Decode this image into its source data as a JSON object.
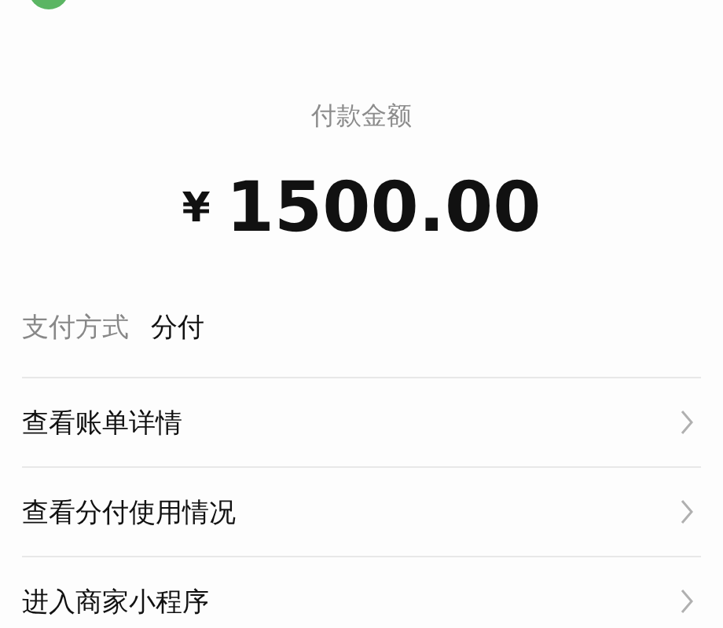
{
  "title": "付款金额",
  "amount": {
    "currency": "¥",
    "value": "1500.00"
  },
  "payment_method": {
    "label": "支付方式",
    "value": "分付"
  },
  "actions": [
    {
      "label": "查看账单详情"
    },
    {
      "label": "查看分付使用情况"
    },
    {
      "label": "进入商家小程序"
    }
  ]
}
